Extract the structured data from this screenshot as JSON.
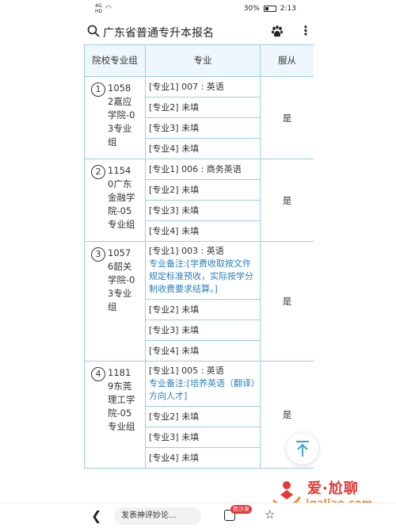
{
  "status_bar": {
    "signal_top": "4G",
    "signal_bottom": "HD",
    "battery": "30%",
    "time": "2:13"
  },
  "header": {
    "title": "广东省普通专升本报名"
  },
  "table": {
    "headers": [
      "院校专业组",
      "专业",
      "服从"
    ],
    "groups": [
      {
        "num": "1",
        "school": "10582嘉应学院-03专业组",
        "obey": "是",
        "majors": [
          {
            "text": "[专业1] 007 : 英语",
            "note": ""
          },
          {
            "text": "[专业2] 未填",
            "note": ""
          },
          {
            "text": "[专业3] 未填",
            "note": ""
          },
          {
            "text": "[专业4] 未填",
            "note": ""
          }
        ]
      },
      {
        "num": "2",
        "school": "11540广东金融学院-05专业组",
        "obey": "是",
        "majors": [
          {
            "text": "[专业1] 006 : 商务英语",
            "note": ""
          },
          {
            "text": "[专业2] 未填",
            "note": ""
          },
          {
            "text": "[专业3] 未填",
            "note": ""
          },
          {
            "text": "[专业4] 未填",
            "note": ""
          }
        ]
      },
      {
        "num": "3",
        "school": "10576韶关学院-03专业组",
        "obey": "是",
        "majors": [
          {
            "text": "[专业1] 003 : 英语",
            "note": "专业备注:[学费收取按文件规定标准预收，实际按学分制收费要求结算。]"
          },
          {
            "text": "[专业2] 未填",
            "note": ""
          },
          {
            "text": "[专业3] 未填",
            "note": ""
          },
          {
            "text": "[专业4] 未填",
            "note": ""
          }
        ]
      },
      {
        "num": "4",
        "school": "11819东莞理工学院-05专业组",
        "obey": "是",
        "majors": [
          {
            "text": "[专业1] 005 : 英语",
            "note": "专业备注:[培养英语（翻译）方向人才]"
          },
          {
            "text": "[专业2] 未填",
            "note": ""
          },
          {
            "text": "[专业3] 未填",
            "note": ""
          },
          {
            "text": "[专业4] 未填",
            "note": ""
          }
        ]
      }
    ]
  },
  "watermark": {
    "title": "爱·尬聊",
    "url": "igaliao.com"
  },
  "bottom_bar": {
    "comment_placeholder": "发表神评妙论...",
    "sofa_badge": "抢沙发"
  },
  "icons": {
    "search": "search-icon",
    "paw": "baidu-paw-icon",
    "more": "more-vertical-icon",
    "back": "back-arrow-icon",
    "comment": "comment-icon",
    "star": "star-icon",
    "scroll_top": "arrow-up-icon"
  }
}
